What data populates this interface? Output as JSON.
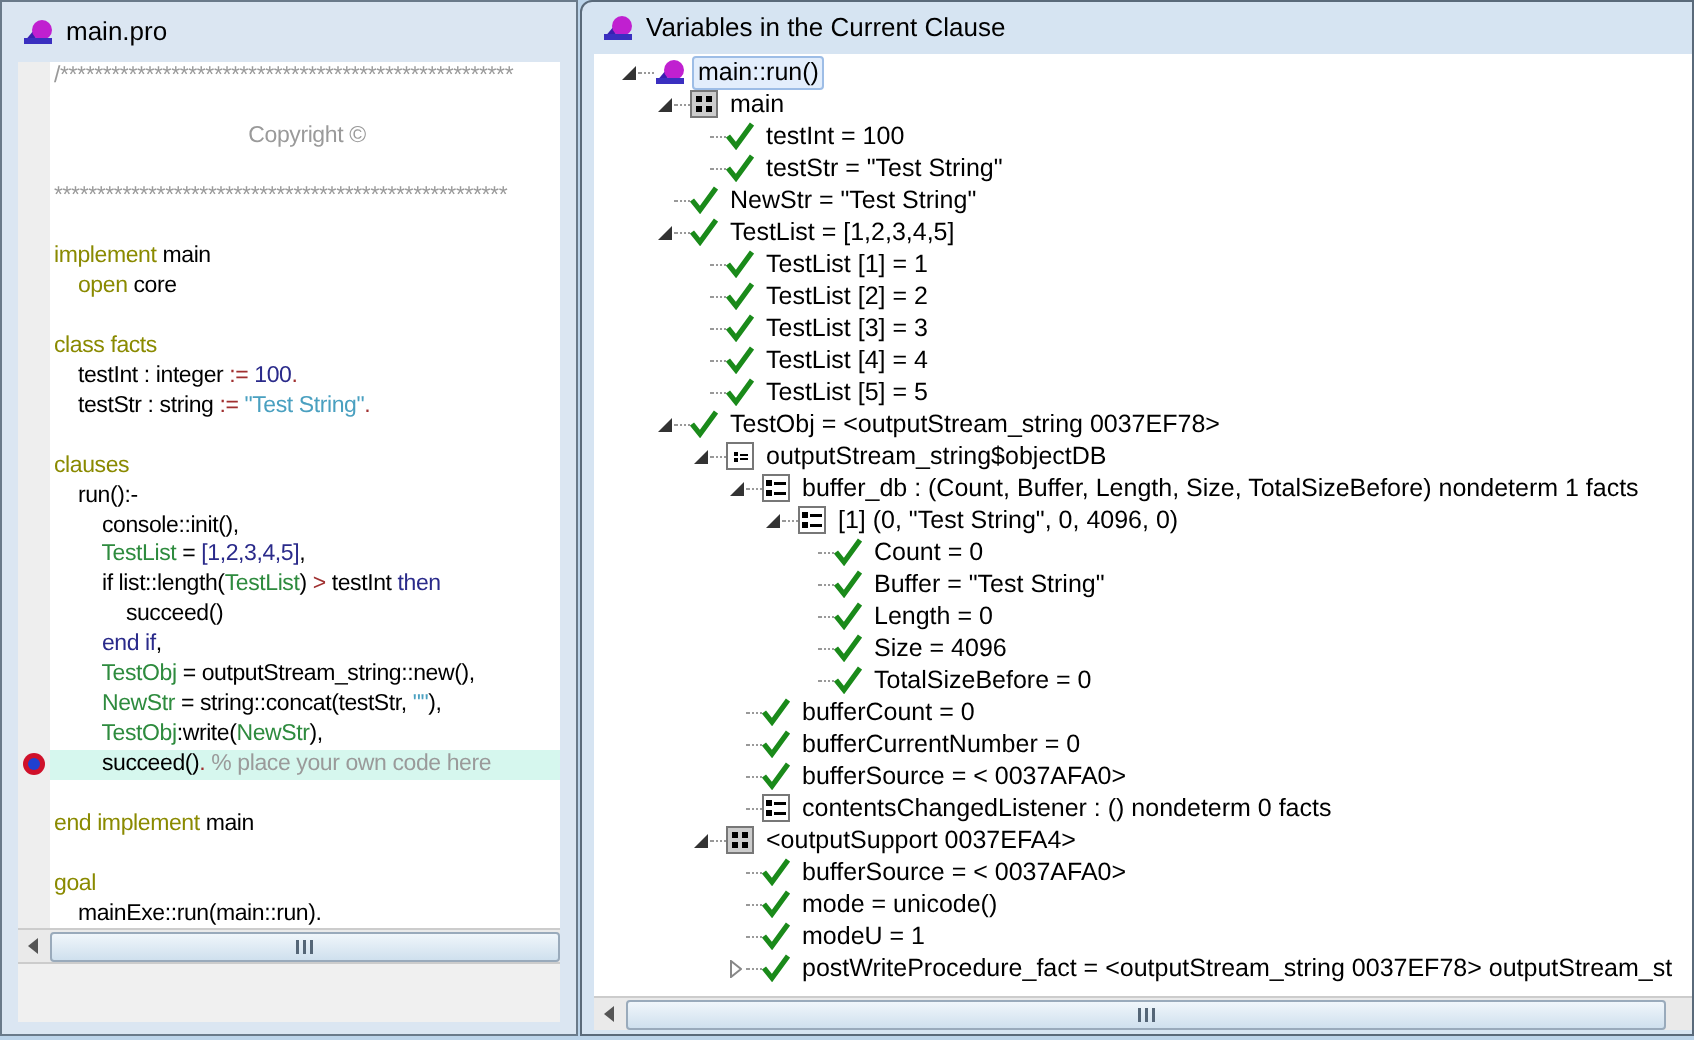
{
  "editor": {
    "title": "main.pro",
    "lines": [
      {
        "breakpoint": false,
        "current": false,
        "tokens": [
          {
            "kind": "comment",
            "text": "/*****************************************************"
          }
        ]
      },
      {
        "breakpoint": false,
        "current": false
      },
      {
        "breakpoint": false,
        "current": false,
        "centered": true,
        "tokens": [
          {
            "kind": "comment",
            "text": "Copyright ©"
          }
        ]
      },
      {
        "breakpoint": false,
        "current": false
      },
      {
        "breakpoint": false,
        "current": false,
        "tokens": [
          {
            "kind": "comment",
            "text": "*****************************************************"
          }
        ]
      },
      {
        "breakpoint": false,
        "current": false
      },
      {
        "breakpoint": false,
        "current": false,
        "tokens": [
          {
            "kind": "kw",
            "text": "implement"
          },
          {
            "kind": "plain",
            "text": " main"
          }
        ]
      },
      {
        "breakpoint": false,
        "current": false,
        "tokens": [
          {
            "kind": "kw",
            "text": "    open"
          },
          {
            "kind": "plain",
            "text": " core"
          }
        ]
      },
      {
        "breakpoint": false,
        "current": false
      },
      {
        "breakpoint": false,
        "current": false,
        "tokens": [
          {
            "kind": "kw",
            "text": "class facts"
          }
        ]
      },
      {
        "breakpoint": false,
        "current": false,
        "tokens": [
          {
            "kind": "plain",
            "text": "    testInt : integer "
          },
          {
            "kind": "op",
            "text": ":="
          },
          {
            "kind": "num",
            "text": " 100"
          },
          {
            "kind": "op",
            "text": "."
          }
        ]
      },
      {
        "breakpoint": false,
        "current": false,
        "tokens": [
          {
            "kind": "plain",
            "text": "    testStr : string "
          },
          {
            "kind": "op",
            "text": ":="
          },
          {
            "kind": "str",
            "text": " \"Test String\""
          },
          {
            "kind": "op",
            "text": "."
          }
        ]
      },
      {
        "breakpoint": false,
        "current": false
      },
      {
        "breakpoint": false,
        "current": false,
        "tokens": [
          {
            "kind": "kw",
            "text": "clauses"
          }
        ]
      },
      {
        "breakpoint": false,
        "current": false,
        "tokens": [
          {
            "kind": "plain",
            "text": "    run():-"
          }
        ]
      },
      {
        "breakpoint": false,
        "current": false,
        "tokens": [
          {
            "kind": "plain",
            "text": "        console::init(),"
          }
        ]
      },
      {
        "breakpoint": false,
        "current": false,
        "tokens": [
          {
            "kind": "var",
            "text": "        TestList"
          },
          {
            "kind": "plain",
            "text": " = "
          },
          {
            "kind": "num",
            "text": "[1,2,3,4,5]"
          },
          {
            "kind": "plain",
            "text": ","
          }
        ]
      },
      {
        "breakpoint": false,
        "current": false,
        "tokens": [
          {
            "kind": "plain",
            "text": "        if list::length("
          },
          {
            "kind": "var",
            "text": "TestList"
          },
          {
            "kind": "plain",
            "text": ") "
          },
          {
            "kind": "op",
            "text": ">"
          },
          {
            "kind": "plain",
            "text": " testInt "
          },
          {
            "kind": "num",
            "text": "then"
          }
        ]
      },
      {
        "breakpoint": false,
        "current": false,
        "tokens": [
          {
            "kind": "plain",
            "text": "            succeed()"
          }
        ]
      },
      {
        "breakpoint": false,
        "current": false,
        "tokens": [
          {
            "kind": "num",
            "text": "        end if"
          },
          {
            "kind": "plain",
            "text": ","
          }
        ]
      },
      {
        "breakpoint": false,
        "current": false,
        "tokens": [
          {
            "kind": "var",
            "text": "        TestObj"
          },
          {
            "kind": "plain",
            "text": " = outputStream_string::new(),"
          }
        ]
      },
      {
        "breakpoint": false,
        "current": false,
        "tokens": [
          {
            "kind": "var",
            "text": "        NewStr"
          },
          {
            "kind": "plain",
            "text": " = string::concat(testStr, "
          },
          {
            "kind": "str",
            "text": "\"\""
          },
          {
            "kind": "plain",
            "text": "),"
          }
        ]
      },
      {
        "breakpoint": false,
        "current": false,
        "tokens": [
          {
            "kind": "var",
            "text": "        TestObj"
          },
          {
            "kind": "plain",
            "text": ":write("
          },
          {
            "kind": "var",
            "text": "NewStr"
          },
          {
            "kind": "plain",
            "text": "),"
          }
        ]
      },
      {
        "breakpoint": true,
        "current": true,
        "tokens": [
          {
            "kind": "plain",
            "text": "        succeed()"
          },
          {
            "kind": "op",
            "text": "."
          },
          {
            "kind": "comment",
            "text": " % place your own code here"
          }
        ]
      },
      {
        "breakpoint": false,
        "current": false
      },
      {
        "breakpoint": false,
        "current": false,
        "tokens": [
          {
            "kind": "kw",
            "text": "end implement"
          },
          {
            "kind": "plain",
            "text": " main"
          }
        ]
      },
      {
        "breakpoint": false,
        "current": false
      },
      {
        "breakpoint": false,
        "current": false,
        "tokens": [
          {
            "kind": "kw",
            "text": "goal"
          }
        ]
      },
      {
        "breakpoint": false,
        "current": false,
        "tokens": [
          {
            "kind": "plain",
            "text": "    mainExe::run(main::run)."
          }
        ]
      }
    ]
  },
  "variables": {
    "title": "Variables in the Current Clause",
    "tree": [
      {
        "kind": "function",
        "label": "main::run()",
        "selected": true,
        "expanded": true,
        "children": [
          {
            "kind": "module",
            "label": "main",
            "selected": false,
            "expanded": true,
            "children": [
              {
                "kind": "var",
                "label": "testInt = 100",
                "selected": false
              },
              {
                "kind": "var",
                "label": "testStr = \"Test String\"",
                "selected": false
              }
            ]
          },
          {
            "kind": "var",
            "label": "NewStr = \"Test String\"",
            "selected": false
          },
          {
            "kind": "var",
            "label": "TestList = [1,2,3,4,5]",
            "selected": false,
            "expanded": true,
            "children": [
              {
                "kind": "var",
                "label": "TestList [1] = 1",
                "selected": false
              },
              {
                "kind": "var",
                "label": "TestList [2] = 2",
                "selected": false
              },
              {
                "kind": "var",
                "label": "TestList [3] = 3",
                "selected": false
              },
              {
                "kind": "var",
                "label": "TestList [4] = 4",
                "selected": false
              },
              {
                "kind": "var",
                "label": "TestList [5] = 5",
                "selected": false
              }
            ]
          },
          {
            "kind": "var",
            "label": "TestObj = <outputStream_string 0037EF78>",
            "selected": false,
            "expanded": true,
            "children": [
              {
                "kind": "object",
                "label": "outputStream_string$objectDB",
                "selected": false,
                "expanded": true,
                "children": [
                  {
                    "kind": "facts",
                    "label": "buffer_db : (Count, Buffer, Length, Size, TotalSizeBefore) nondeterm 1 facts",
                    "selected": false,
                    "expanded": true,
                    "children": [
                      {
                        "kind": "facts",
                        "label": "[1] (0, \"Test String\", 0, 4096, 0)",
                        "selected": false,
                        "expanded": true,
                        "children": [
                          {
                            "kind": "var",
                            "label": "Count = 0",
                            "selected": false
                          },
                          {
                            "kind": "var",
                            "label": "Buffer = \"Test String\"",
                            "selected": false
                          },
                          {
                            "kind": "var",
                            "label": "Length = 0",
                            "selected": false
                          },
                          {
                            "kind": "var",
                            "label": "Size = 4096",
                            "selected": false
                          },
                          {
                            "kind": "var",
                            "label": "TotalSizeBefore = 0",
                            "selected": false
                          }
                        ]
                      }
                    ]
                  },
                  {
                    "kind": "var",
                    "label": "bufferCount = 0",
                    "selected": false
                  },
                  {
                    "kind": "var",
                    "label": "bufferCurrentNumber = 0",
                    "selected": false
                  },
                  {
                    "kind": "var",
                    "label": "bufferSource = < 0037AFA0>",
                    "selected": false
                  },
                  {
                    "kind": "facts",
                    "label": "contentsChangedListener : () nondeterm 0 facts",
                    "selected": false
                  }
                ]
              },
              {
                "kind": "module",
                "label": "<outputSupport 0037EFA4>",
                "selected": false,
                "expanded": true,
                "children": [
                  {
                    "kind": "var",
                    "label": "bufferSource = < 0037AFA0>",
                    "selected": false
                  },
                  {
                    "kind": "var",
                    "label": "mode = unicode()",
                    "selected": false
                  },
                  {
                    "kind": "var",
                    "label": "modeU = 1",
                    "selected": false
                  },
                  {
                    "kind": "var",
                    "label": "postWriteProcedure_fact = <outputStream_string 0037EF78> outputStream_st",
                    "selected": false,
                    "expanded": false
                  }
                ]
              }
            ]
          }
        ]
      }
    ]
  }
}
